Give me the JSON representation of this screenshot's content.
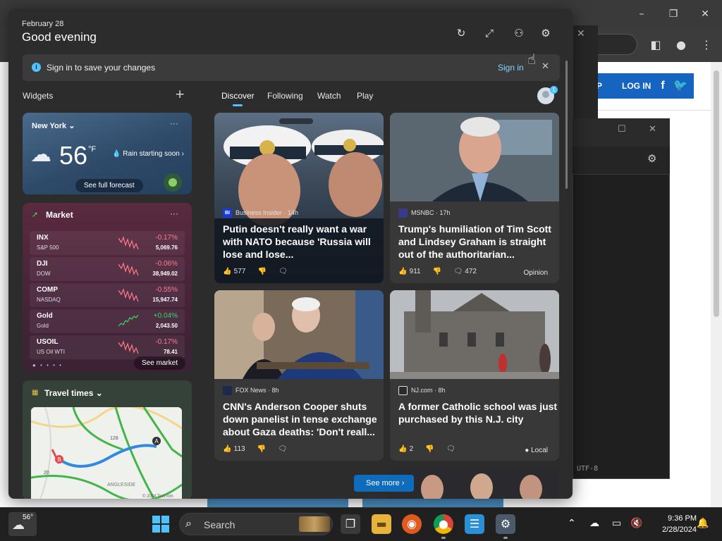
{
  "background_browser": {
    "login_label": "LOG IN",
    "partial_label": "P",
    "encoding_label": "UTF-8"
  },
  "panel": {
    "date": "February 28",
    "greeting": "Good evening",
    "signin_message": "Sign in to save your changes",
    "signin_link": "Sign in",
    "widgets_label": "Widgets",
    "tabs": [
      "Discover",
      "Following",
      "Watch",
      "Play"
    ],
    "active_tab": "Discover",
    "profile_badge": "1",
    "see_more": "See more"
  },
  "weather": {
    "location": "New York",
    "temperature": "56",
    "unit": "°F",
    "condition": "Rain starting soon",
    "forecast_button": "See full forecast"
  },
  "market": {
    "title": "Market",
    "see_market": "See market",
    "rows": [
      {
        "symbol": "INX",
        "name": "S&P 500",
        "change": "-0.17%",
        "price": "5,069.76",
        "trend": "down"
      },
      {
        "symbol": "DJI",
        "name": "DOW",
        "change": "-0.06%",
        "price": "38,949.02",
        "trend": "down"
      },
      {
        "symbol": "COMP",
        "name": "NASDAQ",
        "change": "-0.55%",
        "price": "15,947.74",
        "trend": "down"
      },
      {
        "symbol": "Gold",
        "name": "Gold",
        "change": "+0.04%",
        "price": "2,043.50",
        "trend": "up"
      },
      {
        "symbol": "USOIL",
        "name": "US Oil WTI",
        "change": "-0.17%",
        "price": "78.41",
        "trend": "down"
      }
    ]
  },
  "travel": {
    "title": "Travel times",
    "map_labels": {
      "route": "128",
      "area": "ANGLESIDE",
      "road": "20",
      "copyright": "© 2024 TomTom",
      "marker_a": "A",
      "marker_b": "B"
    }
  },
  "news": [
    {
      "source": "Business Insider",
      "source_logo": "BI",
      "age": "14h",
      "title": "Putin doesn't really want a war with NATO because 'Russia will lose and lose...",
      "likes": "577",
      "tag": ""
    },
    {
      "source": "MSNBC",
      "source_logo": "",
      "age": "17h",
      "title": "Trump's humiliation of Tim Scott and Lindsey Graham is straight out of the authoritarian...",
      "likes": "911",
      "comments": "472",
      "tag": "Opinion"
    },
    {
      "source": "FOX News",
      "source_logo": "",
      "age": "8h",
      "title": "CNN's Anderson Cooper shuts down panelist in tense exchange about Gaza deaths: 'Don't reall...",
      "likes": "113",
      "tag": ""
    },
    {
      "source": "NJ.com",
      "source_logo": "",
      "age": "8h",
      "title": "A former Catholic school was just purchased by this N.J. city",
      "likes": "2",
      "tag": "Local"
    }
  ],
  "taskbar": {
    "weather_temp": "56°",
    "search_placeholder": "Search",
    "time": "9:36 PM",
    "date": "2/28/2024"
  },
  "colors": {
    "accent": "#4cc2ff",
    "negative": "#ff7a8a",
    "positive": "#3bd66a",
    "see_more_bg": "#0f6cbd"
  }
}
